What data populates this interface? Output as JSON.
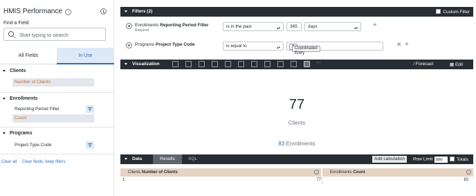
{
  "sidebar": {
    "title": "HMIS Performance",
    "find_label": "Find a Field",
    "search_placeholder": "Start typing to search",
    "tabs": {
      "all": "All Fields",
      "in_use": "In Use"
    },
    "groups": [
      {
        "name": "Clients",
        "fields": [
          {
            "label": "Number of Clients"
          }
        ]
      },
      {
        "name": "Enrollments",
        "fields": [
          {
            "label": "Reporting Period Filter"
          },
          {
            "label": "Count"
          }
        ]
      },
      {
        "name": "Programs",
        "fields": [
          {
            "label": "Project Type Code"
          }
        ]
      }
    ],
    "clear_all": "Clear all",
    "clear_fields": "Clear fields, keep filters"
  },
  "filters": {
    "title": "Filters (2)",
    "custom_filter": "Custom Filter",
    "rows": [
      {
        "view": "Enrollments",
        "field": "Reporting Period Filter",
        "sub": "Required",
        "operator": "is in the past",
        "value": "365",
        "unit": "days"
      },
      {
        "view": "Programs",
        "field": "Project Type Code",
        "operator": "is equal to",
        "chip": "Coordinated Entry"
      }
    ]
  },
  "visualization": {
    "title": "Visualization",
    "more": "···",
    "forecast": "Forecast",
    "edit": "Edit",
    "value": "77",
    "label": "Clients",
    "comparison_value": "83",
    "comparison_label": "Enrollments"
  },
  "data": {
    "title": "Data",
    "tab_results": "Results",
    "tab_sql": "SQL",
    "add_calculation": "Add calculation",
    "row_limit_label": "Row Limit",
    "row_limit": "500",
    "totals": "Totals",
    "columns": [
      {
        "view": "Clients",
        "field": "Number of Clients"
      },
      {
        "view": "Enrollments",
        "field": "Count"
      }
    ],
    "rows": [
      {
        "index": "1",
        "clients": "77",
        "count": "83"
      }
    ]
  }
}
